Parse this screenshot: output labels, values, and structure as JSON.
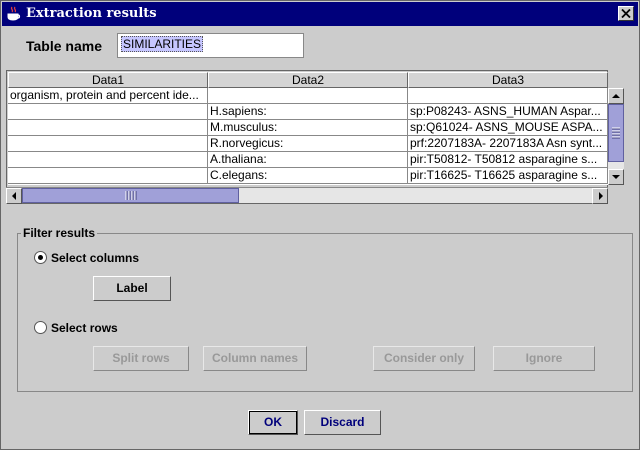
{
  "window": {
    "title": "Extraction results"
  },
  "table_name": {
    "label": "Table name",
    "value": "SIMILARITIES"
  },
  "table": {
    "headers": [
      "Data1",
      "Data2",
      "Data3"
    ],
    "rows": [
      [
        "organism, protein and percent ide...",
        "",
        ""
      ],
      [
        "",
        "H.sapiens:",
        "sp:P08243- ASNS_HUMAN Aspar..."
      ],
      [
        "",
        "M.musculus:",
        "sp:Q61024- ASNS_MOUSE ASPA..."
      ],
      [
        "",
        "R.norvegicus:",
        "prf:2207183A- 2207183A Asn synt..."
      ],
      [
        "",
        "A.thaliana:",
        "pir:T50812- T50812 asparagine s..."
      ],
      [
        "",
        "C.elegans:",
        "pir:T16625- T16625 asparagine s..."
      ]
    ]
  },
  "filter": {
    "title": "Filter results",
    "select_columns_label": "Select columns",
    "select_rows_label": "Select rows",
    "label_button": "Label",
    "split_rows_button": "Split rows",
    "column_names_button": "Column names",
    "consider_only_button": "Consider only",
    "ignore_button": "Ignore"
  },
  "actions": {
    "ok_button": "OK",
    "discard_button": "Discard"
  },
  "colors": {
    "title_bar": "#00007b",
    "selection": "#c6c6ff",
    "scroll_thumb": "#a0a0d8"
  }
}
